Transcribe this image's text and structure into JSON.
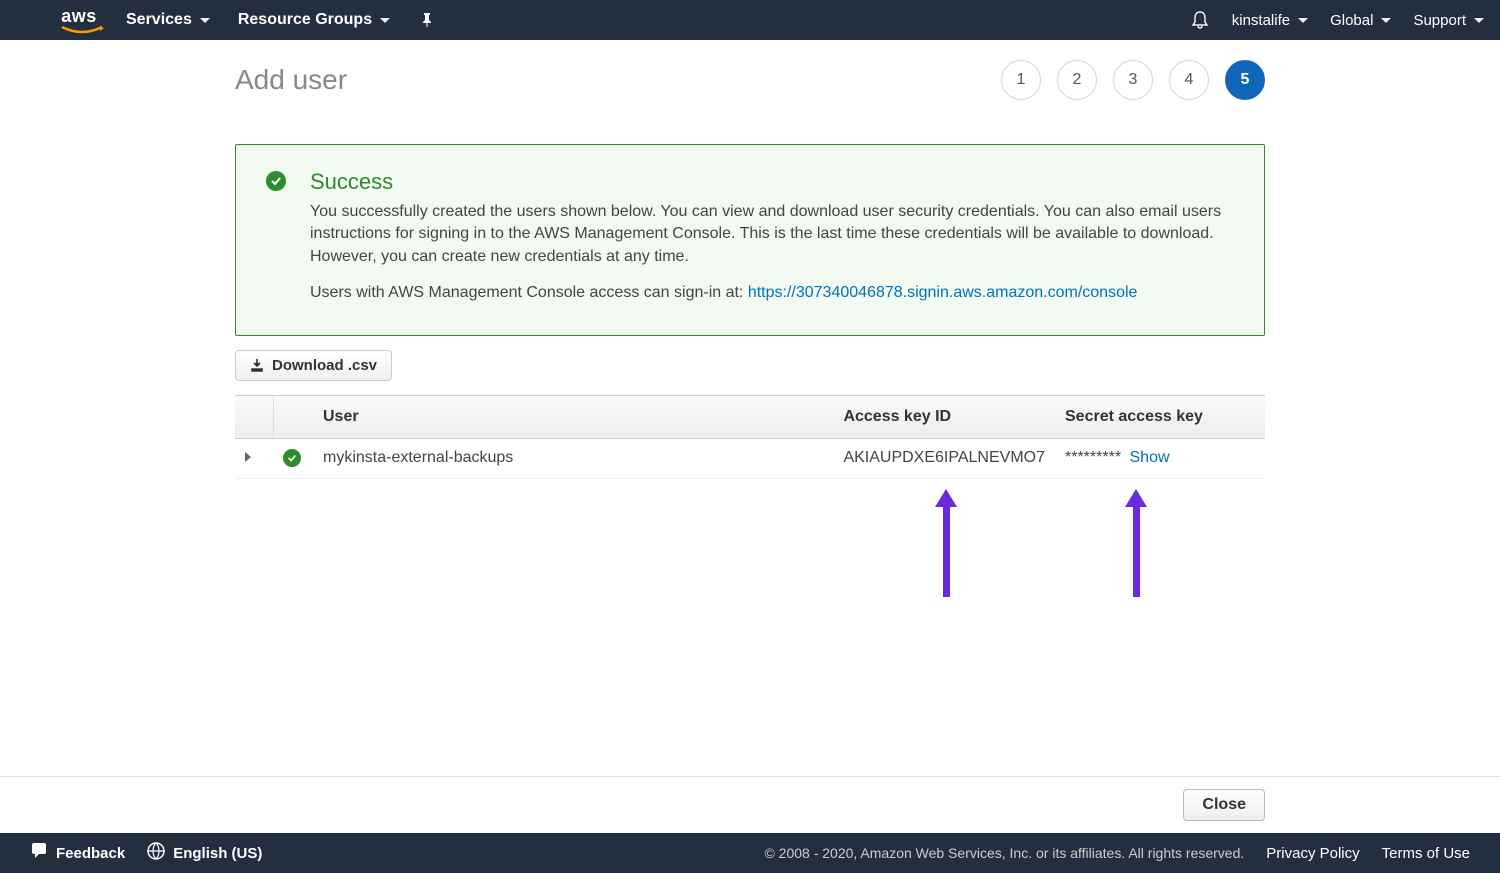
{
  "topnav": {
    "logo_text": "aws",
    "services": "Services",
    "resource_groups": "Resource Groups",
    "account": "kinstalife",
    "region": "Global",
    "support": "Support"
  },
  "page": {
    "title": "Add user",
    "steps": [
      "1",
      "2",
      "3",
      "4",
      "5"
    ],
    "active_step": 5
  },
  "alert": {
    "title": "Success",
    "body1": "You successfully created the users shown below. You can view and download user security credentials. You can also email users instructions for signing in to the AWS Management Console. This is the last time these credentials will be available to download. However, you can create new credentials at any time.",
    "body2_prefix": "Users with AWS Management Console access can sign-in at: ",
    "signin_url": "https://307340046878.signin.aws.amazon.com/console"
  },
  "buttons": {
    "download_csv": "Download .csv",
    "close": "Close"
  },
  "table": {
    "headers": {
      "user": "User",
      "access_key_id": "Access key ID",
      "secret": "Secret access key"
    },
    "rows": [
      {
        "user": "mykinsta-external-backups",
        "access_key_id": "AKIAUPDXE6IPALNEVMO7",
        "secret_masked": "*********",
        "show_label": "Show"
      }
    ]
  },
  "footer": {
    "feedback": "Feedback",
    "language": "English (US)",
    "copyright": "© 2008 - 2020, Amazon Web Services, Inc. or its affiliates. All rights reserved.",
    "privacy": "Privacy Policy",
    "terms": "Terms of Use"
  }
}
